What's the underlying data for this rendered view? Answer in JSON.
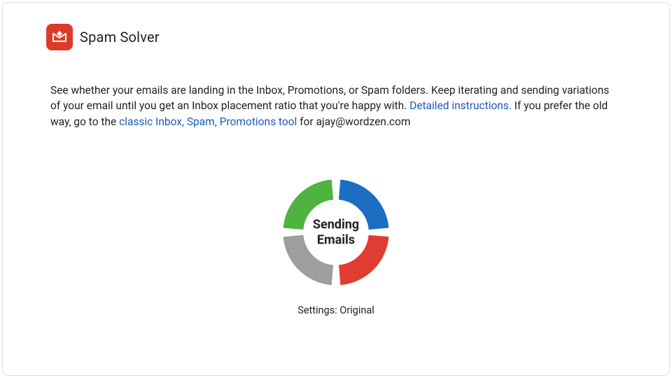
{
  "header": {
    "title": "Spam Solver"
  },
  "description": {
    "text1": "See whether your emails are landing in the Inbox, Promotions, or Spam folders. Keep iterating and sending variations of your email until you get an Inbox placement ratio that you're happy with. ",
    "link1": "Detailed instructions.",
    "text2": " If you prefer the old way, go to the ",
    "link2": "classic Inbox, Spam, Promotions tool",
    "text3": " for ajay@wordzen.com"
  },
  "spinner": {
    "center_line1": "Sending",
    "center_line2": "Emails",
    "settings_label": "Settings: Original"
  },
  "colors": {
    "red": "#e03c31",
    "blue": "#1b6ec2",
    "green": "#4fb33f",
    "gray": "#9e9e9e",
    "logo_bg": "#dd3b2a"
  },
  "chart_data": {
    "type": "pie",
    "title": "Sending Emails",
    "series": [
      {
        "name": "blue",
        "value": 25,
        "color": "#1b6ec2"
      },
      {
        "name": "red",
        "value": 25,
        "color": "#e03c31"
      },
      {
        "name": "gray",
        "value": 25,
        "color": "#9e9e9e"
      },
      {
        "name": "green",
        "value": 25,
        "color": "#4fb33f"
      }
    ]
  }
}
